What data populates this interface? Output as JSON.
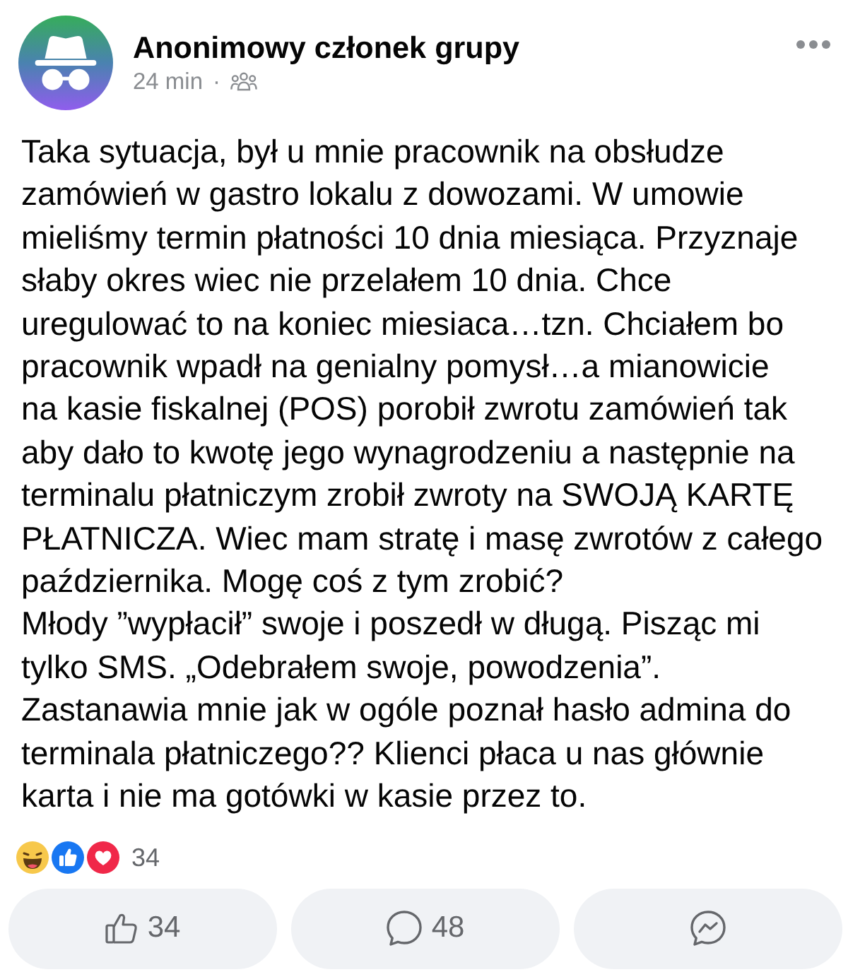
{
  "post": {
    "author": "Anonimowy członek grupy",
    "time": "24 min",
    "separator": "·"
  },
  "body": {
    "lines": [
      "Taka sytuacja, był u mnie pracownik na obsłudze",
      "zamówień w gastro lokalu z dowozami. W umowie",
      "mieliśmy termin płatności 10 dnia miesiąca. Przyznaje",
      "słaby okres wiec nie przelałem 10 dnia. Chce",
      "uregulować to na koniec miesiaca…tzn. Chciałem bo",
      "pracownik wpadł na genialny pomysł…a mianowicie",
      "na kasie fiskalnej (POS) porobił zwrotu zamówień tak",
      "aby dało to kwotę jego wynagrodzeniu a następnie na",
      "terminalu płatniczym zrobił zwroty na SWOJĄ KARTĘ",
      "PŁATNICZA. Wiec mam stratę i masę zwrotów z całego",
      "października. Mogę coś z tym zrobić?",
      "Młody ”wypłacił” swoje i poszedł w długą. Pisząc mi",
      "tylko SMS. „Odebrałem swoje, powodzenia”.",
      "Zastanawia mnie jak w ogóle poznał hasło admina do",
      "terminala płatniczego?? Klienci płaca u nas głównie",
      "karta i nie ma gotówki w kasie przez to."
    ]
  },
  "reactions": {
    "count": "34"
  },
  "actions": [
    {
      "kind": "like",
      "count": "34"
    },
    {
      "kind": "comment",
      "count": "48"
    },
    {
      "kind": "send"
    }
  ]
}
